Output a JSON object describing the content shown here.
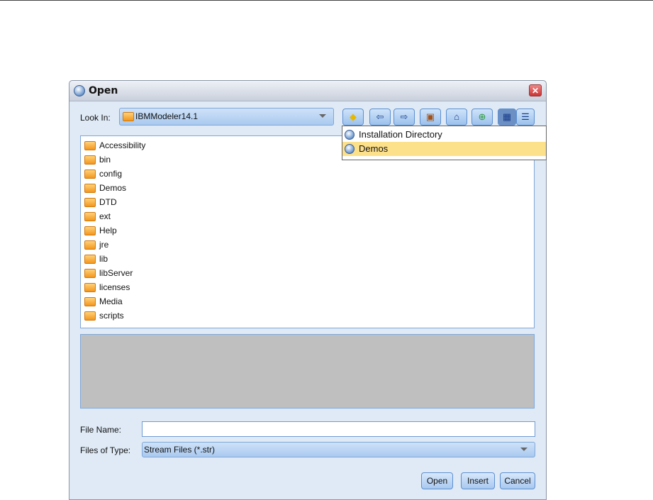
{
  "dialog": {
    "title": "Open"
  },
  "look_in": {
    "label": "Look In:",
    "value": "IBMModeler14.1"
  },
  "toolbar": [
    "favorites",
    "back",
    "forward",
    "up-folder",
    "home",
    "new-folder",
    "list-view",
    "details-view"
  ],
  "files": [
    "Accessibility",
    "bin",
    "config",
    "Demos",
    "DTD",
    "ext",
    "Help",
    "jre",
    "lib",
    "libServer",
    "licenses",
    "Media",
    "scripts"
  ],
  "popup": {
    "items": [
      "Installation Directory",
      "Demos"
    ],
    "highlighted": "Demos"
  },
  "file_name": {
    "label": "File Name:",
    "value": ""
  },
  "file_type": {
    "label": "Files of Type:",
    "value": "Stream Files (*.str)"
  },
  "buttons": {
    "open": "Open",
    "insert": "Insert",
    "cancel": "Cancel"
  }
}
